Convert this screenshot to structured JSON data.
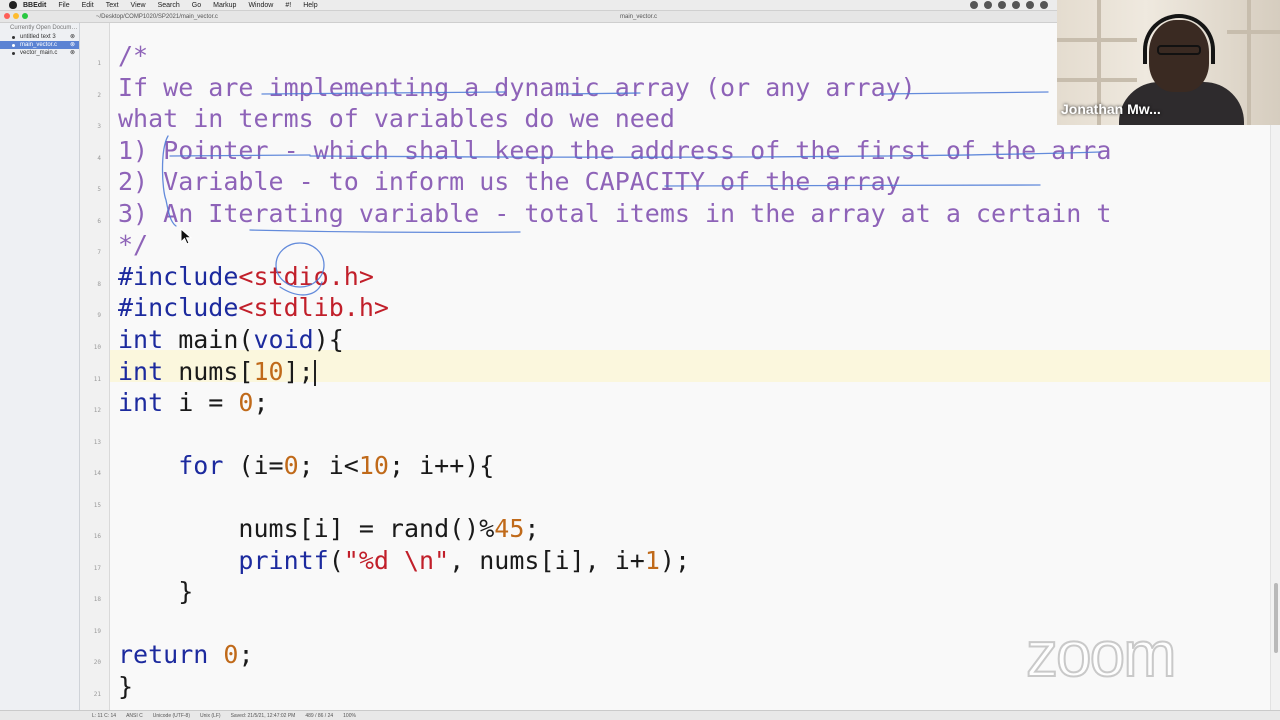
{
  "menubar": {
    "items": [
      "BBEdit",
      "File",
      "Edit",
      "Text",
      "View",
      "Search",
      "Go",
      "Markup",
      "Window",
      "#!",
      "Help"
    ]
  },
  "titlebar": {
    "path": "~/Desktop/COMP1020/SP2021/main_vector.c",
    "window_title": "main_vector.c"
  },
  "sidebar": {
    "header": "Currently Open Docum…",
    "items": [
      {
        "label": "untitled text 3",
        "selected": false
      },
      {
        "label": "main_vector.c",
        "selected": true
      },
      {
        "label": "vector_main.c",
        "selected": false
      }
    ]
  },
  "gutter": {
    "line_numbers": [
      "1",
      "2",
      "3",
      "4",
      "5",
      "6",
      "7",
      "8",
      "9",
      "10",
      "11",
      "12",
      "13",
      "14",
      "15",
      "16",
      "17",
      "18",
      "19",
      "20",
      "21"
    ]
  },
  "editor": {
    "lines": [
      {
        "parts": [
          {
            "t": "/*",
            "c": "comment"
          }
        ]
      },
      {
        "parts": [
          {
            "t": "If we are implementing a dynamic array (or any array)",
            "c": "comment"
          }
        ]
      },
      {
        "parts": [
          {
            "t": "what in terms of variables do we need",
            "c": "comment"
          }
        ]
      },
      {
        "parts": [
          {
            "t": "1) Pointer - which shall keep the address of the first of the arra",
            "c": "comment"
          }
        ]
      },
      {
        "parts": [
          {
            "t": "2) Variable - to inform us the CAPACITY of the array",
            "c": "comment"
          }
        ]
      },
      {
        "parts": [
          {
            "t": "3) An Iterating variable - total items in the array at a certain t",
            "c": "comment"
          }
        ]
      },
      {
        "parts": [
          {
            "t": "*/",
            "c": "comment"
          }
        ]
      },
      {
        "parts": [
          {
            "t": "#include",
            "c": "kw"
          },
          {
            "t": "<stdio.h>",
            "c": "str"
          }
        ]
      },
      {
        "parts": [
          {
            "t": "#include",
            "c": "kw"
          },
          {
            "t": "<stdlib.h>",
            "c": "str"
          }
        ]
      },
      {
        "parts": [
          {
            "t": "int",
            "c": "kw"
          },
          {
            "t": " main(",
            "c": ""
          },
          {
            "t": "void",
            "c": "kw"
          },
          {
            "t": "){",
            "c": ""
          }
        ]
      },
      {
        "parts": [
          {
            "t": "int",
            "c": "kw"
          },
          {
            "t": " nums[",
            "c": ""
          },
          {
            "t": "10",
            "c": "num"
          },
          {
            "t": "];",
            "c": ""
          }
        ],
        "caret": true
      },
      {
        "parts": [
          {
            "t": "int",
            "c": "kw"
          },
          {
            "t": " i = ",
            "c": ""
          },
          {
            "t": "0",
            "c": "num"
          },
          {
            "t": ";",
            "c": ""
          }
        ]
      },
      {
        "parts": []
      },
      {
        "parts": [
          {
            "t": "    ",
            "c": ""
          },
          {
            "t": "for",
            "c": "kw"
          },
          {
            "t": " (i=",
            "c": ""
          },
          {
            "t": "0",
            "c": "num"
          },
          {
            "t": "; i<",
            "c": ""
          },
          {
            "t": "10",
            "c": "num"
          },
          {
            "t": "; i++){",
            "c": ""
          }
        ]
      },
      {
        "parts": []
      },
      {
        "parts": [
          {
            "t": "        nums[i] = rand()%",
            "c": ""
          },
          {
            "t": "45",
            "c": "num"
          },
          {
            "t": ";",
            "c": ""
          }
        ]
      },
      {
        "parts": [
          {
            "t": "        ",
            "c": ""
          },
          {
            "t": "printf",
            "c": "kw"
          },
          {
            "t": "(",
            "c": ""
          },
          {
            "t": "\"%d \\n\"",
            "c": "str"
          },
          {
            "t": ", nums[i], i+",
            "c": ""
          },
          {
            "t": "1",
            "c": "num"
          },
          {
            "t": ");",
            "c": ""
          }
        ]
      },
      {
        "parts": [
          {
            "t": "    }",
            "c": ""
          }
        ]
      },
      {
        "parts": []
      },
      {
        "parts": [
          {
            "t": "return",
            "c": "kw"
          },
          {
            "t": " ",
            "c": ""
          },
          {
            "t": "0",
            "c": "num"
          },
          {
            "t": ";",
            "c": ""
          }
        ]
      },
      {
        "parts": [
          {
            "t": "}",
            "c": ""
          }
        ]
      }
    ]
  },
  "statusbar": {
    "items": [
      "L: 11 C: 14",
      "ANSI C",
      "Unicode (UTF-8)",
      "Unix (LF)",
      "Saved: 21/5/21, 12:47:02 PM",
      "489 / 86 / 24",
      "100%"
    ]
  },
  "webcam": {
    "participant_name": "Jonathan Mw..."
  },
  "watermark": {
    "text": "zoom"
  },
  "colors": {
    "comment": "#8e63b8",
    "keyword": "#1c2a9e",
    "string": "#c11f2a",
    "number": "#c06a1a",
    "annotation_ink": "#4a78d6"
  }
}
